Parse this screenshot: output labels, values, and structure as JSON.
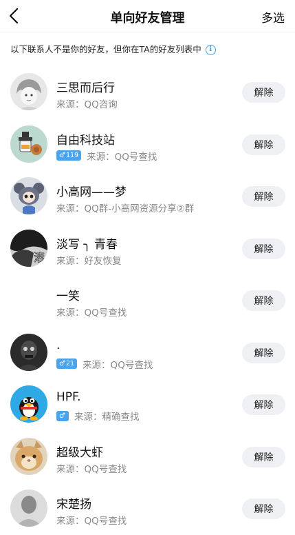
{
  "header": {
    "title": "单向好友管理",
    "multi_select": "多选"
  },
  "notice": {
    "text": "以下联系人不是你的好友，但你在TA的好友列表中",
    "info_glyph": "i"
  },
  "remove_label": "解除",
  "contacts": [
    {
      "name": "三思而后行",
      "source": "来源：QQ咨询",
      "badge": null
    },
    {
      "name": "自由科技站",
      "source": "来源：QQ号查找",
      "badge": "119"
    },
    {
      "name": "小高网——梦",
      "source": "来源：QQ群-小高网资源分享②群",
      "badge": null
    },
    {
      "name": "淡写 ╮ 青春",
      "source": "来源：好友恢复",
      "badge": null,
      "avatar_text": "滚"
    },
    {
      "name": "一笑",
      "source": "来源：QQ号查找",
      "badge": null
    },
    {
      "name": ".",
      "source": "来源：QQ号查找",
      "badge": "21"
    },
    {
      "name": "HPF.",
      "source": "来源：精确查找",
      "badge": ""
    },
    {
      "name": "超级大虾",
      "source": "来源：QQ号查找",
      "badge": null
    },
    {
      "name": "宋楚扬",
      "source": "来源：QQ号查找",
      "badge": null
    }
  ],
  "colors": {
    "accent": "#4da3ea",
    "button_bg": "#eff0f3",
    "secondary_text": "#888888"
  }
}
